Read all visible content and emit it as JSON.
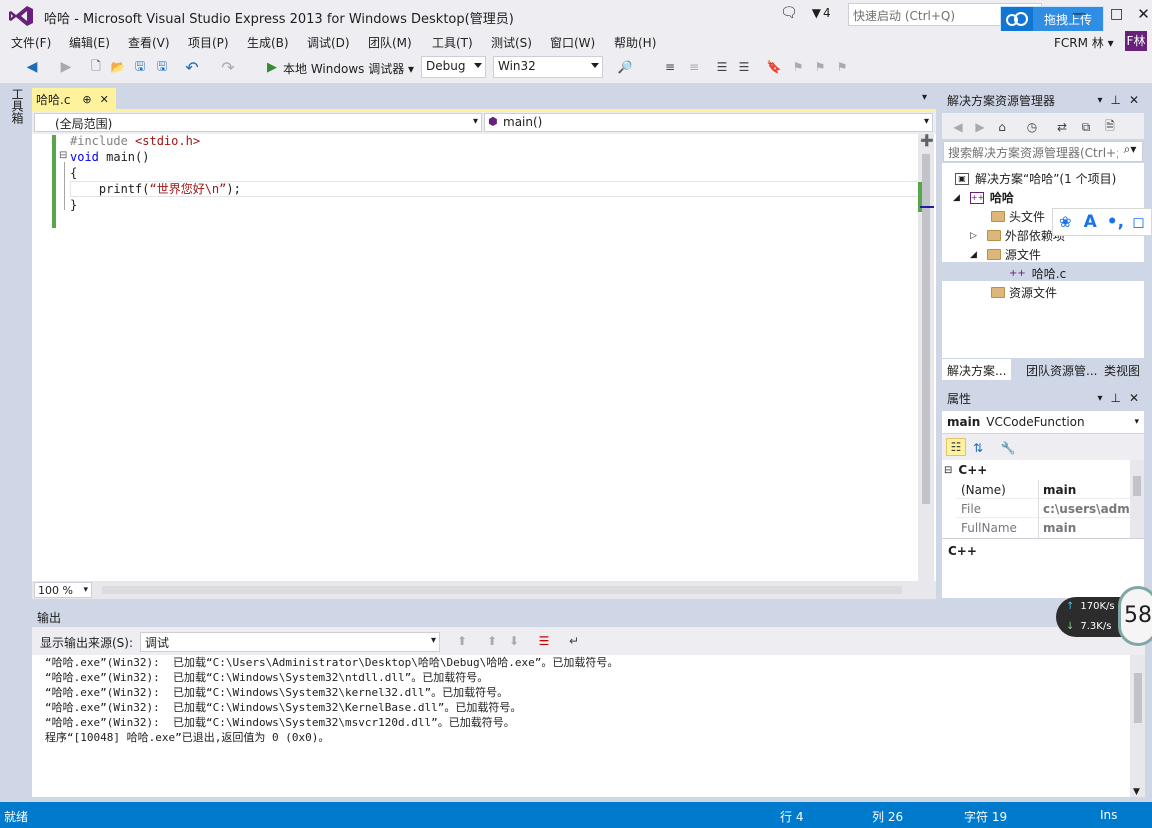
{
  "window": {
    "title": "哈哈 - Microsoft Visual Studio Express 2013 for Windows Desktop(管理员)",
    "notifications": "4",
    "quick_launch_placeholder": "快速启动 (Ctrl+Q)"
  },
  "baidu": {
    "upload_label": "拖拽上传"
  },
  "menu": [
    "文件(F)",
    "编辑(E)",
    "查看(V)",
    "项目(P)",
    "生成(B)",
    "调试(D)",
    "团队(M)",
    "工具(T)",
    "测试(S)",
    "窗口(W)",
    "帮助(H)"
  ],
  "user": {
    "name": "FCRM 林 ▾",
    "avatar_text": "F林"
  },
  "toolbar": {
    "debugger_label": "本地 Windows 调试器",
    "config": "Debug",
    "platform": "Win32"
  },
  "left_strip": {
    "toolbox": "工具箱"
  },
  "editor": {
    "tab_name": "哈哈.c",
    "scope": "(全局范围)",
    "function": "main()",
    "zoom": "100 %",
    "lines": {
      "l1a": "#include",
      "l1b": " <stdio.h>",
      "l2a": "void",
      "l2b": " main()",
      "l3": "{",
      "l4a": "    printf(",
      "l4b": "“世界您好\\n”",
      "l4c": ");",
      "l5": "}"
    }
  },
  "solution_explorer": {
    "title": "解决方案资源管理器",
    "search_placeholder": "搜索解决方案资源管理器(Ctrl+;)",
    "solution": "解决方案“哈哈”(1 个项目)",
    "project": "哈哈",
    "items": {
      "headers": "头文件",
      "external": "外部依赖项",
      "source": "源文件",
      "file": "哈哈.c",
      "resources": "资源文件"
    },
    "tabs": [
      "解决方案...",
      "团队资源管...",
      "类视图"
    ]
  },
  "properties": {
    "title": "属性",
    "object_name": "main",
    "object_type": "VCCodeFunction",
    "category": "C++",
    "rows": [
      {
        "name": "(Name)",
        "value": "main"
      },
      {
        "name": "File",
        "value": "c:\\users\\admi"
      },
      {
        "name": "FullName",
        "value": "main"
      }
    ],
    "description": "C++"
  },
  "output": {
    "title": "输出",
    "source_label": "显示输出来源(S):",
    "source_value": "调试",
    "lines": [
      "“哈哈.exe”(Win32):  已加载“C:\\Users\\Administrator\\Desktop\\哈哈\\Debug\\哈哈.exe”。已加载符号。",
      "“哈哈.exe”(Win32):  已加载“C:\\Windows\\System32\\ntdll.dll”。已加载符号。",
      "“哈哈.exe”(Win32):  已加载“C:\\Windows\\System32\\kernel32.dll”。已加载符号。",
      "“哈哈.exe”(Win32):  已加载“C:\\Windows\\System32\\KernelBase.dll”。已加载符号。",
      "“哈哈.exe”(Win32):  已加载“C:\\Windows\\System32\\msvcr120d.dll”。已加载符号。",
      "程序“[10048] 哈哈.exe”已退出,返回值为 0 (0x0)。"
    ]
  },
  "net_monitor": {
    "up": "170K/s",
    "down": "7.3K/s",
    "gauge": "58"
  },
  "status": {
    "ready": "就绪",
    "line": "行 4",
    "col": "列 26",
    "char": "字符 19",
    "mode": "Ins"
  },
  "colors": {
    "accent": "#007acc",
    "tab_active": "#fff29d",
    "vs_purple": "#68217a"
  }
}
